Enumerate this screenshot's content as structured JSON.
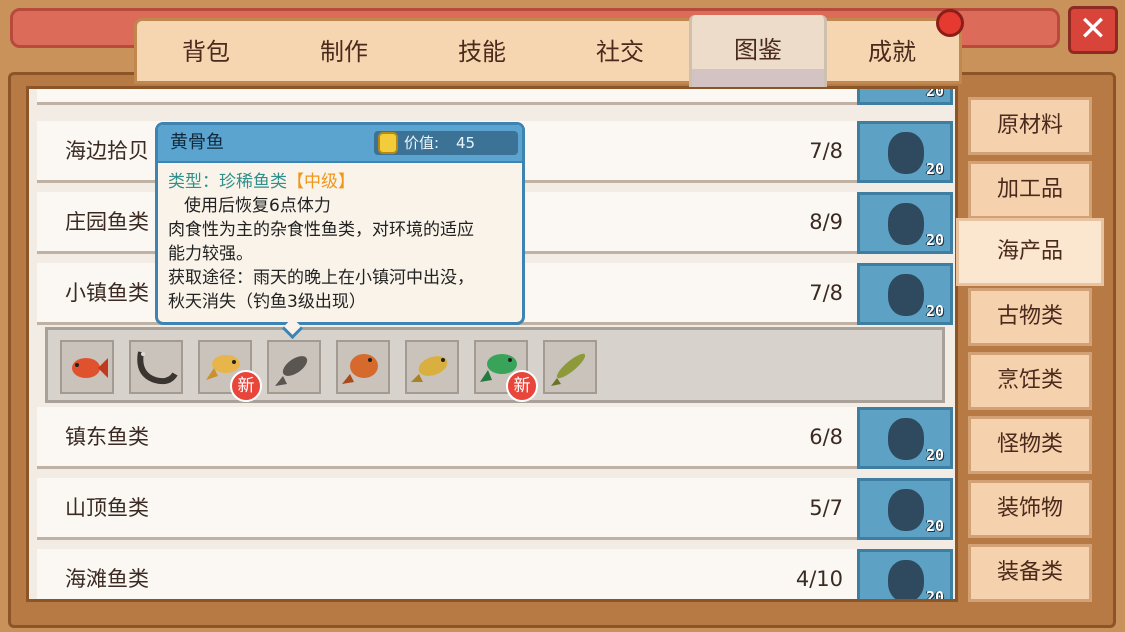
{
  "window": {
    "close_label": "✕"
  },
  "tabs": [
    {
      "label": "背包"
    },
    {
      "label": "制作"
    },
    {
      "label": "技能"
    },
    {
      "label": "社交"
    },
    {
      "label": "图鉴",
      "active": true
    },
    {
      "label": "成就"
    }
  ],
  "categories": [
    {
      "label": "原材料"
    },
    {
      "label": "加工品"
    },
    {
      "label": "海产品",
      "active": true
    },
    {
      "label": "古物类"
    },
    {
      "label": "烹饪类"
    },
    {
      "label": "怪物类"
    },
    {
      "label": "装饰物"
    },
    {
      "label": "装备类"
    }
  ],
  "collection_rows": [
    {
      "name": "海边拾贝",
      "count": "7/8",
      "reward": "20"
    },
    {
      "name": "庄园鱼类",
      "count": "8/9",
      "reward": "20"
    },
    {
      "name": "小镇鱼类",
      "count": "7/8",
      "reward": "20"
    },
    {
      "name": "镇东鱼类",
      "count": "6/8",
      "reward": "20"
    },
    {
      "name": "山顶鱼类",
      "count": "5/7",
      "reward": "20"
    },
    {
      "name": "海滩鱼类",
      "count": "4/10",
      "reward": "20"
    }
  ],
  "top_partial_reward": "20",
  "fish_items": [
    {
      "icon": "red-fish-icon",
      "new": false
    },
    {
      "icon": "eel-icon",
      "new": false
    },
    {
      "icon": "yellow-fish-icon",
      "new": true
    },
    {
      "icon": "unknown-fish-silhouette-icon",
      "new": false
    },
    {
      "icon": "orange-flat-fish-icon",
      "new": false
    },
    {
      "icon": "golden-fish-icon",
      "new": false
    },
    {
      "icon": "green-fish-icon",
      "new": true
    },
    {
      "icon": "pike-fish-icon",
      "new": false
    }
  ],
  "new_badge_label": "新",
  "tooltip": {
    "title": "黄骨鱼",
    "value_label": "价值:",
    "value": "45",
    "type_label": "类型：珍稀鱼类",
    "grade": "【中级】",
    "effect": "使用后恢复6点体力",
    "desc_line1": "肉食性为主的杂食性鱼类，对环境的适应",
    "desc_line2": "能力较强。",
    "source_line1": "获取途径：雨天的晚上在小镇河中出没，",
    "source_line2": "秋天消失（钓鱼3级出现）"
  },
  "colors": {
    "tab_bar": "#f6d6b0",
    "reward_blue": "#5da1c4",
    "tooltip_border": "#3d84b3",
    "grade_orange": "#f0971b",
    "type_teal": "#2f8f8a",
    "badge_red": "#e8463b"
  }
}
